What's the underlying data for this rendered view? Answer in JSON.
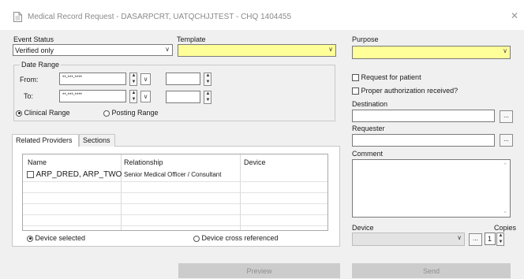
{
  "window": {
    "title": "Medical Record Request - DASARPCRT, UATQCHJJTEST - CHQ 1404455",
    "close_glyph": "✕"
  },
  "event_status": {
    "label": "Event Status",
    "value": "Verified only"
  },
  "template": {
    "label": "Template",
    "value": ""
  },
  "date_range": {
    "label": "Date Range",
    "from_label": "From:",
    "to_label": "To:",
    "from_value": "**-***-****",
    "to_value": "**-***-****",
    "from_time": "",
    "to_time": ""
  },
  "range_type": {
    "clinical": "Clinical Range",
    "posting": "Posting Range",
    "selected": "clinical"
  },
  "tabs": [
    {
      "label": "Related Providers"
    },
    {
      "label": "Sections"
    }
  ],
  "providers_table": {
    "columns": [
      "Name",
      "Relationship",
      "Device"
    ],
    "rows": [
      {
        "name": "ARP_DRED, ARP_TWO",
        "relationship": "Senior Medical Officer / Consultant",
        "device": "",
        "checked": false
      }
    ]
  },
  "device_filter": {
    "selected_label": "Device selected",
    "cross_label": "Device cross referenced",
    "selected": "selected"
  },
  "purpose": {
    "label": "Purpose",
    "value": ""
  },
  "checks": {
    "request_for_patient": "Request for patient",
    "proper_auth": "Proper authorization received?"
  },
  "destination": {
    "label": "Destination",
    "value": ""
  },
  "requester": {
    "label": "Requester",
    "value": ""
  },
  "comment": {
    "label": "Comment",
    "value": ""
  },
  "device": {
    "label": "Device",
    "value": ""
  },
  "copies": {
    "label": "Copies",
    "value": "1"
  },
  "buttons": {
    "preview": "Preview",
    "send": "Send",
    "ellipsis": "..."
  },
  "colors": {
    "required_field": "#ffff99",
    "disabled_button": "#cccccc"
  }
}
